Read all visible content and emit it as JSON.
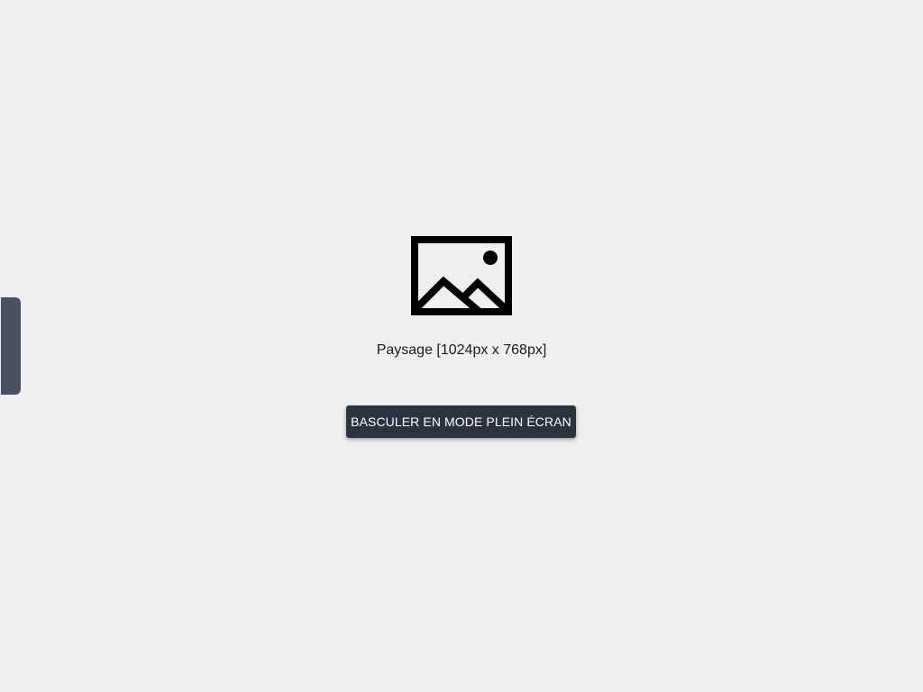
{
  "side_panel": {
    "handle_color": "#4a5160"
  },
  "placeholder": {
    "icon": "image-icon",
    "caption": "Paysage [1024px x 768px]"
  },
  "fullscreen": {
    "button_label": "BASCULER EN MODE PLEIN ÉCRAN",
    "button_color": "#2b3240"
  },
  "colors": {
    "background": "#efefef",
    "text": "#1a1a1a"
  }
}
